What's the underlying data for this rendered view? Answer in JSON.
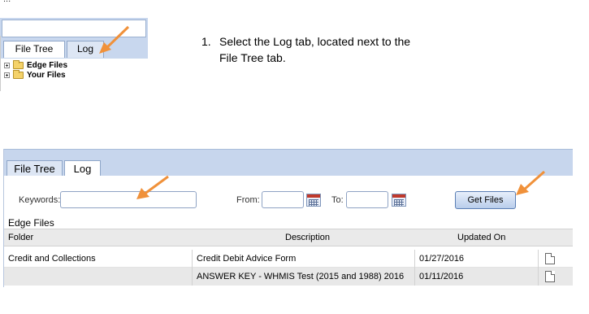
{
  "top_screenshot": {
    "cut_title": "...",
    "tabs": [
      {
        "label": "File Tree",
        "active": true
      },
      {
        "label": "Log",
        "active": false
      }
    ],
    "tree": [
      {
        "label": "Edge Files"
      },
      {
        "label": "Your Files"
      }
    ]
  },
  "instruction": {
    "number": "1.",
    "text": "Select the Log tab, located next to the File Tree tab."
  },
  "bottom_screenshot": {
    "tabs": [
      {
        "label": "File Tree",
        "active": false
      },
      {
        "label": "Log",
        "active": true
      }
    ],
    "search": {
      "keywords_label": "Keywords:",
      "keywords_value": "",
      "from_label": "From:",
      "from_value": "",
      "to_label": "To:",
      "to_value": "",
      "get_files_label": "Get Files"
    },
    "section_title": "Edge Files",
    "table": {
      "columns": [
        "Folder",
        "Description",
        "Updated On"
      ],
      "rows": [
        {
          "folder": "Credit and Collections",
          "description": "Credit Debit Advice Form",
          "updated": "01/27/2016"
        },
        {
          "folder": "",
          "description": "ANSWER KEY - WHMIS Test (2015 and 1988) 2016",
          "updated": "01/11/2016"
        }
      ]
    }
  },
  "colors": {
    "tab_band": "#c7d6ed",
    "arrow": "#f0913a",
    "table_header": "#eaeaea"
  },
  "icons": [
    "plus-expander-icon",
    "folder-icon",
    "calendar-icon",
    "document-icon",
    "arrow-pointer-icon"
  ]
}
